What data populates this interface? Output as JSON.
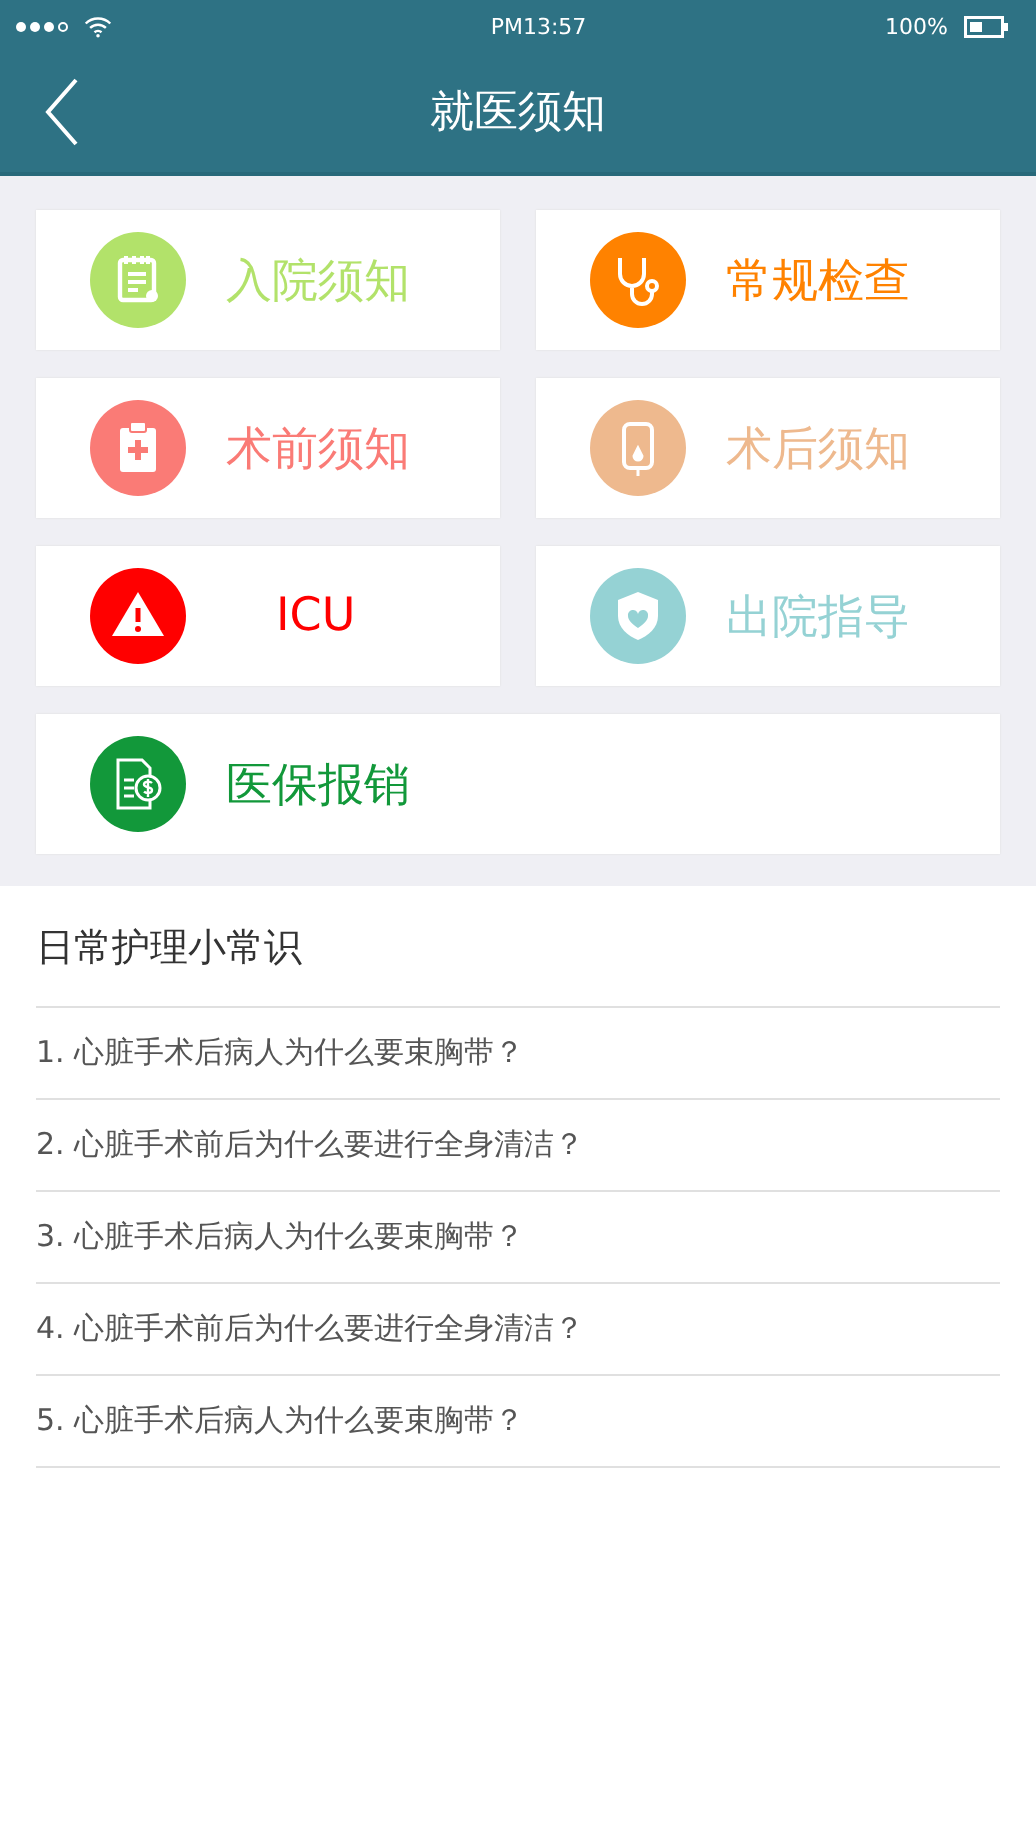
{
  "status_bar": {
    "time": "PM13:57",
    "battery": "100%"
  },
  "nav": {
    "title": "就医须知"
  },
  "tiles": [
    {
      "label": "入院须知",
      "kind": "notepad",
      "color": "#b2e26a"
    },
    {
      "label": "常规检查",
      "kind": "stethoscope",
      "color": "#ff8200"
    },
    {
      "label": "术前须知",
      "kind": "clipboard",
      "color": "#fa7b76"
    },
    {
      "label": "术后须知",
      "kind": "iv-bag",
      "color": "#eeb98e"
    },
    {
      "label": "ICU",
      "kind": "warning",
      "color": "#ff0000"
    },
    {
      "label": "出院指导",
      "kind": "shield",
      "color": "#95d2d4"
    }
  ],
  "wide_tile": {
    "label": "医保报销",
    "kind": "bill",
    "color": "#12983a"
  },
  "tips": {
    "title": "日常护理小常识",
    "items": [
      "1. 心脏手术后病人为什么要束胸带？",
      "2. 心脏手术前后为什么要进行全身清洁？",
      "3. 心脏手术后病人为什么要束胸带？",
      "4. 心脏手术前后为什么要进行全身清洁？",
      "5. 心脏手术后病人为什么要束胸带？"
    ]
  }
}
